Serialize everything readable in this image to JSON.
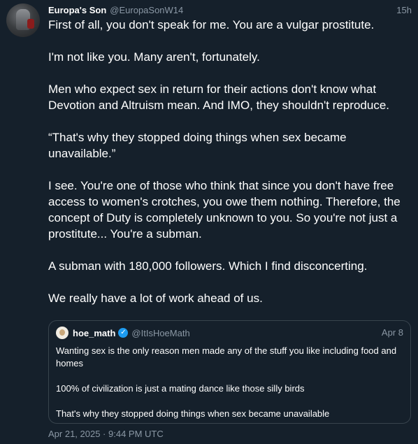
{
  "tweet": {
    "display_name": "Europa's Son",
    "handle": "@EuropaSonW14",
    "time": "15h",
    "paragraphs": [
      "First of all, you don't speak for me. You are a vulgar prostitute.",
      "I'm not like you. Many aren't, fortunately.",
      "Men who expect sex in return for their actions don't know what Devotion and Altruism mean. And IMO, they shouldn't reproduce.",
      "“That's why they stopped doing things when sex became unavailable.”",
      "I see. You're one of those who think that since you don't have free access to women's crotches, you owe them nothing. Therefore, the concept of Duty is completely unknown to you. So you're not just a prostitute... You're a subman.",
      "A subman with 180,000 followers. Which I find disconcerting.",
      "We really have a lot of work ahead of us."
    ],
    "timestamp": "Apr 21, 2025 · 9:44 PM UTC"
  },
  "quote": {
    "display_name": "hoe_math",
    "verified_icon": "verified-check-icon",
    "handle": "@ItIsHoeMath",
    "time": "Apr 8",
    "paragraphs": [
      "Wanting sex is the only reason men made any of the stuff you like including food and homes",
      "100% of civilization is just a mating dance like those silly birds",
      "That's why they stopped doing things when sex became unavailable"
    ]
  },
  "colors": {
    "background": "#15202b",
    "text": "#ffffff",
    "secondary": "#8b98a5",
    "border": "#38444d",
    "verified": "#1d9bf0"
  }
}
